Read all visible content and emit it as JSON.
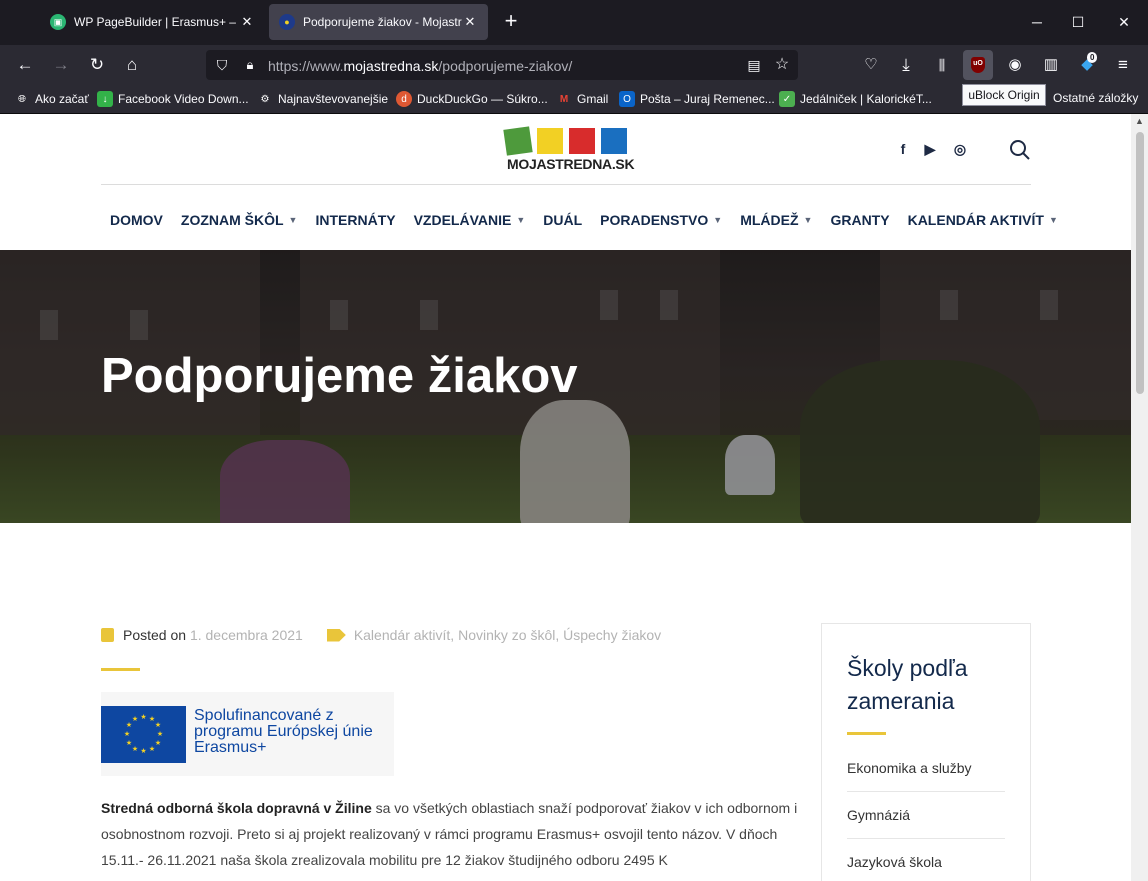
{
  "browser": {
    "tabs": [
      {
        "title": "WP PageBuilder | Erasmus+ – P",
        "active": false
      },
      {
        "title": "Podporujeme žiakov - Mojastre",
        "active": true
      }
    ],
    "new_tab_symbol": "+",
    "close_symbol": "✕",
    "window_controls": {
      "minimize": "─",
      "maximize": "☐",
      "close": "✕"
    },
    "url_prefix": "https://www.",
    "url_domain": "mojastredna.sk",
    "url_path": "/podporujeme-ziakov/",
    "toolbar_badges": {
      "downloads_count": "0"
    },
    "tooltip": "uBlock Origin",
    "bookmarks": [
      {
        "label": "Ako začať",
        "icon": "globe-icon",
        "color": "#fbfbfe"
      },
      {
        "label": "Facebook Video Down...",
        "icon": "download-arrow-icon",
        "color": "#33b249"
      },
      {
        "label": "Najnavštevovanejšie",
        "icon": "gear-icon",
        "color": "#fbfbfe"
      },
      {
        "label": "DuckDuckGo — Súkro...",
        "icon": "duckduckgo-icon",
        "color": "#de5833"
      },
      {
        "label": "Gmail",
        "icon": "gmail-icon",
        "color": "#ea4335"
      },
      {
        "label": "Pošta – Juraj Remenec...",
        "icon": "outlook-icon",
        "color": "#0a64c8"
      },
      {
        "label": "Jedálniček | KalorickéT...",
        "icon": "checkbox-icon",
        "color": "#4caf50"
      }
    ],
    "other_bookmarks": "Ostatné záložky"
  },
  "site": {
    "logo_text": "MOJASTREDNA.SK",
    "logo_colors": [
      "#4e9a3c",
      "#f2d024",
      "#d82c2c",
      "#1a6fc0"
    ],
    "social_icons": [
      "facebook-icon",
      "youtube-icon",
      "instagram-icon"
    ],
    "menu": [
      {
        "label": "DOMOV",
        "dropdown": false
      },
      {
        "label": "ZOZNAM ŠKÔL",
        "dropdown": true
      },
      {
        "label": "INTERNÁTY",
        "dropdown": false
      },
      {
        "label": "VZDELÁVANIE",
        "dropdown": true
      },
      {
        "label": "DUÁL",
        "dropdown": false
      },
      {
        "label": "PORADENSTVO",
        "dropdown": true
      },
      {
        "label": "MLÁDEŽ",
        "dropdown": true
      },
      {
        "label": "GRANTY",
        "dropdown": false
      },
      {
        "label": "KALENDÁR AKTIVÍT",
        "dropdown": true
      }
    ],
    "accent": "#e9c53a",
    "navy": "#13294b"
  },
  "hero": {
    "title": "Podporujeme žiakov"
  },
  "post": {
    "posted_label": "Posted on",
    "date": "1. decembra 2021",
    "categories": "Kalendár aktivít, Novinky zo škôl, Úspechy žiakov",
    "eu_badge_lines": [
      "Spolufinancované z",
      "programu Európskej únie",
      "Erasmus+"
    ],
    "body_bold": "Stredná odborná škola dopravná v Žiline",
    "body_rest": " sa vo všetkých oblastiach snaží podporovať žiakov v ich odbornom i osobnostnom rozvoji. Preto si aj projekt realizovaný v rámci programu Erasmus+ osvojil tento názov. V dňoch 15.11.- 26.11.2021 naša škola zrealizovala mobilitu pre 12 žiakov študijného odboru 2495 K"
  },
  "sidebar": {
    "title": "Školy podľa zamerania",
    "items": [
      "Ekonomika a služby",
      "Gymnáziá",
      "Jazyková škola"
    ]
  }
}
